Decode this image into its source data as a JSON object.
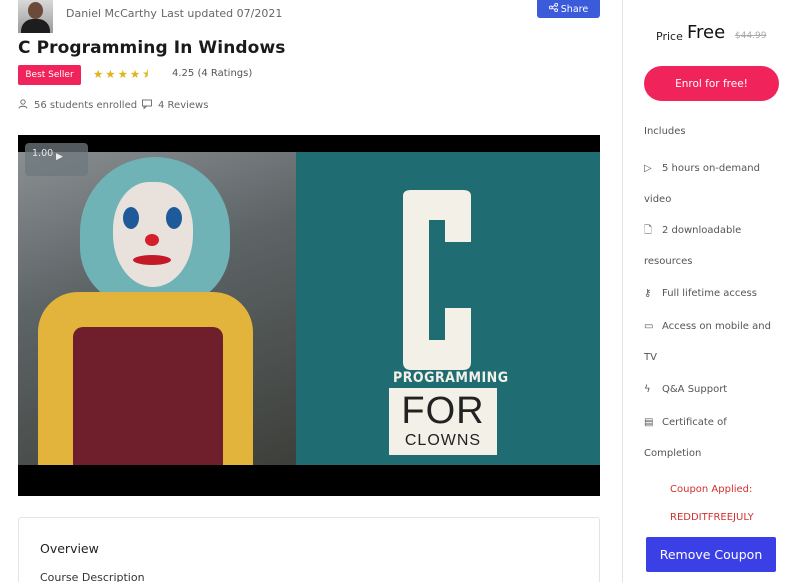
{
  "course": {
    "author": "Daniel McCarthy",
    "last_updated": "Last updated 07/2021",
    "share_label": "Share",
    "title": "C Programming In Windows",
    "badge": "Best Seller",
    "rating_stars": "★★★★⯨",
    "rating_value": 4.25,
    "rating_text": "4.25 (4 Ratings)",
    "enrolled": "56 students enrolled",
    "reviews": "4 Reviews"
  },
  "video": {
    "speed_label": "1.00",
    "big_letter": "C",
    "word1": "PROGRAMMING",
    "word2": "FOR",
    "word3": "CLOWNS"
  },
  "overview": {
    "title": "Overview",
    "subtitle": "Course Description"
  },
  "sidebar": {
    "price_label": "Price",
    "price": "Free",
    "old_price": "$44.99",
    "enrol_label": "Enrol for free!",
    "includes_label": "Includes",
    "features": [
      {
        "icon": "play-icon",
        "text1": "5 hours on-demand",
        "text2": "video"
      },
      {
        "icon": "file-icon",
        "text1": "2 downloadable",
        "text2": "resources"
      },
      {
        "icon": "key-icon",
        "text1": "Full lifetime access",
        "text2": ""
      },
      {
        "icon": "devices-icon",
        "text1": "Access on mobile and",
        "text2": "TV"
      },
      {
        "icon": "bolt-icon",
        "text1": "Q&A Support",
        "text2": ""
      },
      {
        "icon": "certificate-icon",
        "text1": "Certificate of",
        "text2": "Completion"
      }
    ],
    "coupon_applied": "Coupon Applied:",
    "coupon_code": "REDDITFREEJULY",
    "remove_label": "Remove Coupon"
  },
  "colors": {
    "accent_pink": "#f0235b",
    "accent_blue": "#3b3fe6",
    "share_blue": "#3b5bdb",
    "coupon_red": "#d32f2f",
    "star_gold": "#e0b51a"
  }
}
